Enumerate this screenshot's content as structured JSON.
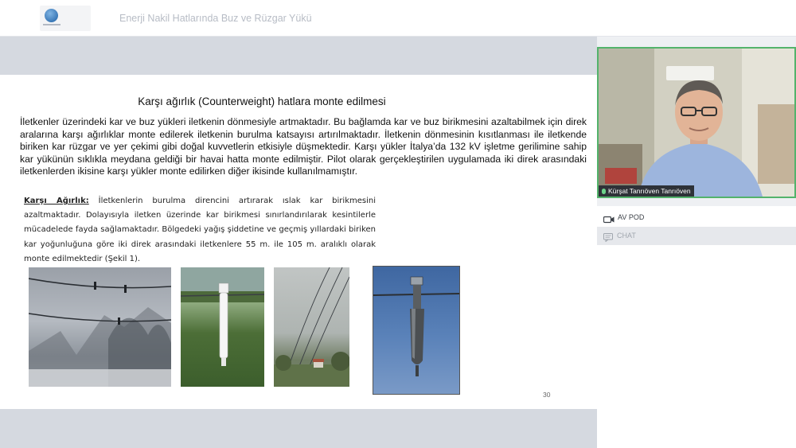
{
  "header": {
    "title": "Enerji Nakil Hatlarında Buz ve Rüzgar Yükü",
    "logo_icon": "globe-logo-icon"
  },
  "slide": {
    "title": "Karşı ağırlık (Counterweight) hatlara monte edilmesi",
    "intro": "İletkenler üzerindeki kar ve buz yükleri iletkenin dönmesiyle artmaktadır. Bu bağlamda kar ve buz birikmesini azaltabilmek için direk aralarına karşı ağırlıklar monte edilerek iletkenin burulma katsayısı artırılmaktadır. İletkenin dönmesinin kısıtlanması ile iletkende biriken kar rüzgar ve yer çekimi gibi doğal kuvvetlerin etkisiyle düşmektedir. Karşı yükler İtalya’da 132 kV işletme gerilimine sahip kar yükünün sıklıkla meydana geldiği bir havai hatta monte edilmiştir. Pilot olarak gerçekleştirilen uygulamada iki direk arasındaki iletkenlerden ikisine karşı yükler monte edilirken diğer ikisinde kullanılmamıştır.",
    "para_lead": "Karşı Ağırlık:",
    "para_body": " İletkenlerin burulma direncini artırarak ıslak kar birikmesini azaltmaktadır. Dolayısıyla iletken üzerinde kar birikmesi sınırlandırılarak kesintilerle mücadelede fayda sağlamaktadır. Bölgedeki yağış şiddetine ve geçmiş yıllardaki biriken kar yoğunluğuna göre iki direk arasındaki iletkenlere 55 m. ile 105 m. aralıklı olarak monte edilmektedir (Şekil 1).",
    "page_number": "30"
  },
  "video": {
    "speaker_name": "Kürşat Tanrıöven Tanrıöven"
  },
  "panel": {
    "av_label": "AV POD",
    "chat_label": "CHAT"
  },
  "colors": {
    "active_speaker_border": "#53b36b",
    "stage_bg": "#d5d9e0",
    "chat_bar_bg": "#e6e8ec"
  }
}
